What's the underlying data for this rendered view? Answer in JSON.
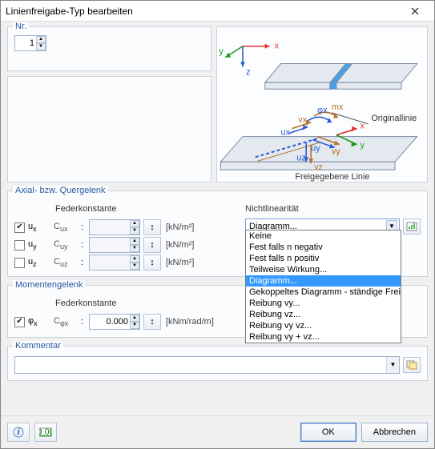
{
  "window": {
    "title": "Linienfreigabe-Typ bearbeiten"
  },
  "nr": {
    "label": "Nr.",
    "value": "1"
  },
  "diagram": {
    "axis_x": "x",
    "axis_y": "y",
    "axis_z": "z",
    "label_original": "Originallinie",
    "label_released": "Freigegebene Linie",
    "small_x": "x",
    "small_y": "y",
    "ux": "ux",
    "uy": "uy",
    "uz": "uz",
    "vx": "vx",
    "vy": "vy",
    "vz": "vz",
    "phix": "φx",
    "mx": "mx"
  },
  "axial": {
    "group_label": "Axial- bzw. Quergelenk",
    "col_spring": "Federkonstante",
    "col_nonlin": "Nichtlinearität",
    "rows": [
      {
        "checked": true,
        "var": "ux",
        "sc": "Cux",
        "value": "",
        "unit": "[kN/m²]"
      },
      {
        "checked": false,
        "var": "uy",
        "sc": "Cuy",
        "value": "",
        "unit": "[kN/m²]"
      },
      {
        "checked": false,
        "var": "uz",
        "sc": "Cuz",
        "value": "",
        "unit": "[kN/m²]"
      }
    ],
    "nonlin_value": "Diagramm...",
    "nonlin_options": [
      "Keine",
      "Fest falls n negativ",
      "Fest falls n positiv",
      "Teilweise Wirkung...",
      "Diagramm...",
      "Gekoppeltes Diagramm - ständige Freigabe",
      "Reibung vy...",
      "Reibung vz...",
      "Reibung vy vz...",
      "Reibung vy + vz..."
    ]
  },
  "moment": {
    "group_label": "Momentengelenk",
    "col_spring": "Federkonstante",
    "row": {
      "checked": true,
      "var": "φx",
      "sc": "Cφx",
      "value": "0.000",
      "unit": "[kNm/rad/m]"
    }
  },
  "comment": {
    "group_label": "Kommentar",
    "value": ""
  },
  "footer": {
    "ok": "OK",
    "cancel": "Abbrechen"
  }
}
